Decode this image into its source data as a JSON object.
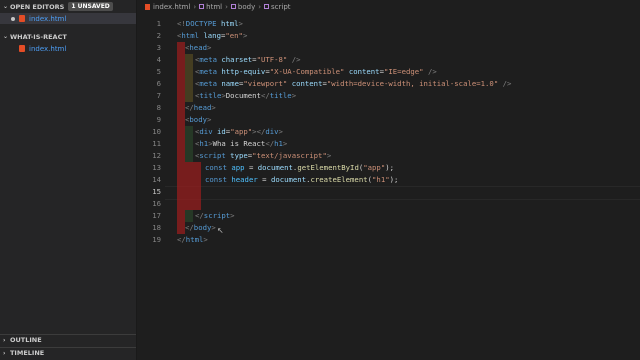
{
  "sidebar": {
    "open_editors": {
      "label": "OPEN EDITORS",
      "badge": "1 UNSAVED",
      "file": "index.html"
    },
    "project": {
      "label": "WHAT-IS-REACT",
      "file": "index.html"
    },
    "outline_label": "OUTLINE",
    "timeline_label": "TIMELINE"
  },
  "breadcrumb": {
    "file": "index.html",
    "items": [
      "html",
      "body",
      "script"
    ]
  },
  "editor": {
    "line_numbers": [
      "1",
      "2",
      "3",
      "4",
      "5",
      "6",
      "7",
      "8",
      "9",
      "10",
      "11",
      "12",
      "13",
      "14",
      "15",
      "16",
      "17",
      "18",
      "19"
    ],
    "active_line": 15
  }
}
